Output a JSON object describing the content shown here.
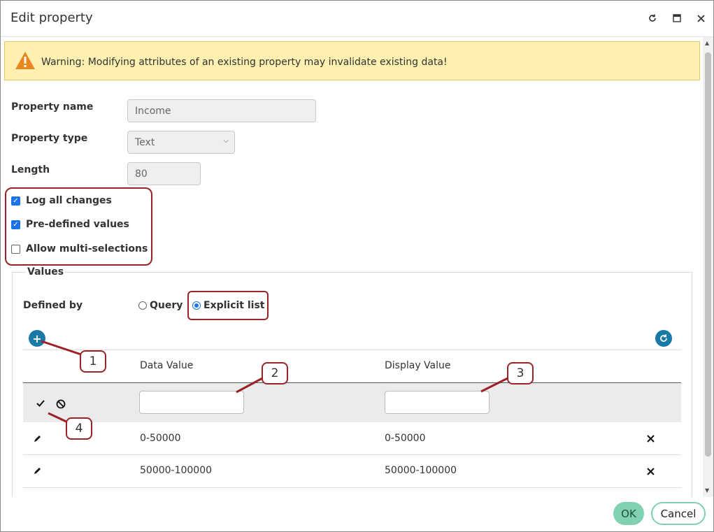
{
  "dialog": {
    "title": "Edit property",
    "warning": "Warning: Modifying attributes of an existing property may invalidate existing data!"
  },
  "form": {
    "property_name_label": "Property name",
    "property_name_value": "Income",
    "property_type_label": "Property type",
    "property_type_value": "Text",
    "length_label": "Length",
    "length_value": "80",
    "checkboxes": [
      {
        "label": "Log all changes",
        "checked": true
      },
      {
        "label": "Pre-defined values",
        "checked": true
      },
      {
        "label": "Allow multi-selections",
        "checked": false
      }
    ]
  },
  "values": {
    "legend": "Values",
    "defined_by_label": "Defined by",
    "options": [
      {
        "label": "Query",
        "selected": false
      },
      {
        "label": "Explicit list",
        "selected": true
      }
    ],
    "columns": [
      "Data Value",
      "Display Value"
    ],
    "rows": [
      {
        "data": "0-50000",
        "display": "0-50000"
      },
      {
        "data": "50000-100000",
        "display": "50000-100000"
      }
    ]
  },
  "callouts": [
    "1",
    "2",
    "3",
    "4"
  ],
  "footer": {
    "ok": "OK",
    "cancel": "Cancel"
  },
  "colors": {
    "accent": "#1a7aa6",
    "annotation": "#9b2226",
    "ok_button": "#7fd1b0",
    "warning_bg": "#fdf0b0"
  }
}
